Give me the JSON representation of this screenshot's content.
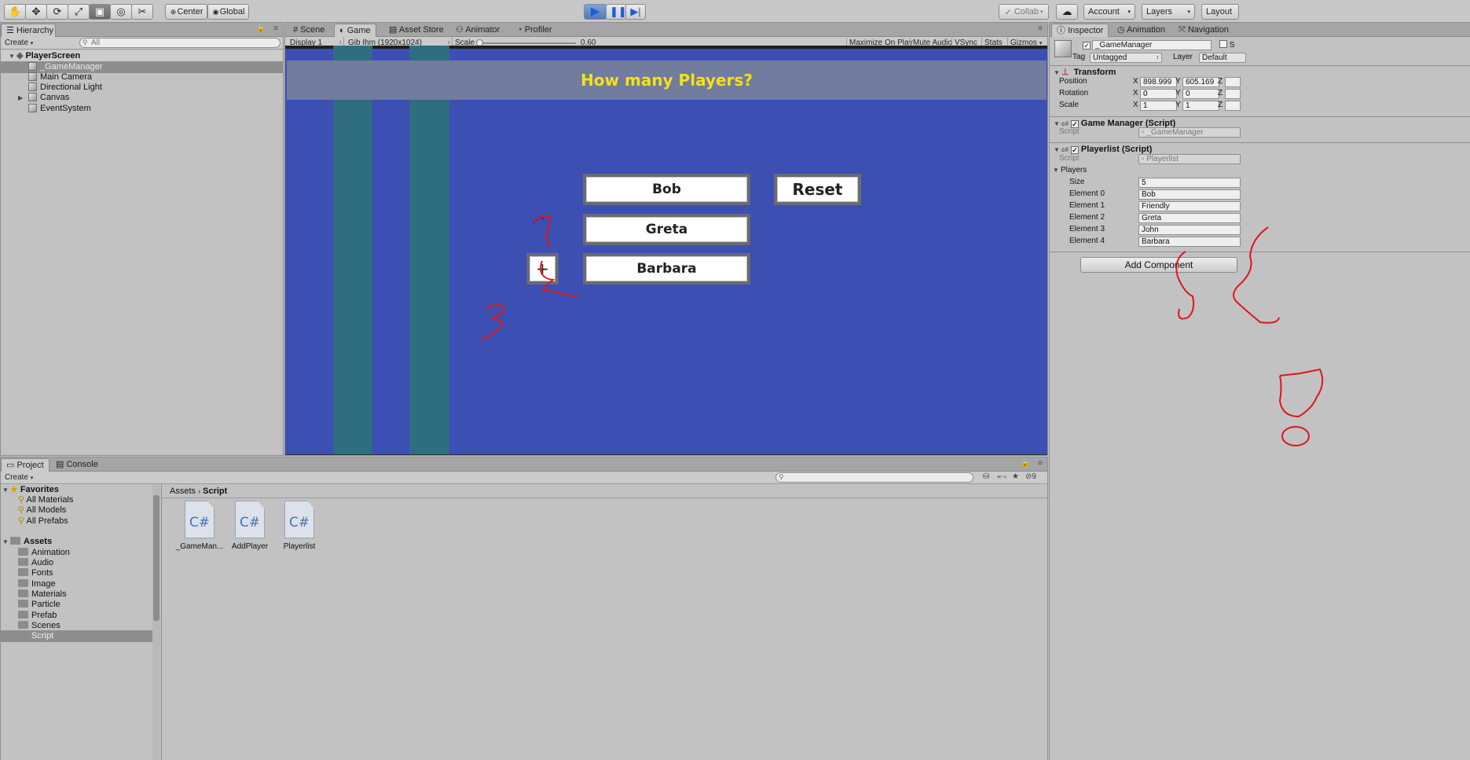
{
  "toolbar": {
    "pivot_center": "Center",
    "pivot_global": "Global",
    "collab": "Collab",
    "account": "Account",
    "layers": "Layers",
    "layout": "Layout"
  },
  "hierarchy": {
    "tab": "Hierarchy",
    "create": "Create",
    "search_placeholder": "All",
    "scene": "PlayerScreen",
    "items": [
      "_GameManager",
      "Main Camera",
      "Directional Light",
      "Canvas",
      "EventSystem"
    ]
  },
  "view_tabs": {
    "scene": "Scene",
    "game": "Game",
    "asset_store": "Asset Store",
    "animator": "Animator",
    "profiler": "Profiler"
  },
  "game_bar": {
    "display": "Display 1",
    "resolution": "Gib Ihm (1920x1024)",
    "scale_label": "Scale",
    "scale_value": "0.60",
    "scale_fraction": 0.0,
    "maximize": "Maximize On Play",
    "mute": "Mute Audio",
    "vsync": "VSync",
    "stats": "Stats",
    "gizmos": "Gizmos"
  },
  "game": {
    "title": "How many Players?",
    "players": [
      "Bob",
      "Greta",
      "Barbara"
    ],
    "reset": "Reset",
    "add": "+"
  },
  "inspector": {
    "tabs": {
      "inspector": "Inspector",
      "animation": "Animation",
      "navigation": "Navigation"
    },
    "object_name": "_GameManager",
    "static_label": "S",
    "tag_label": "Tag",
    "tag": "Untagged",
    "layer_label": "Layer",
    "layer": "Default",
    "transform": {
      "title": "Transform",
      "position_label": "Position",
      "rotation_label": "Rotation",
      "scale_label": "Scale",
      "position": {
        "x": "898.999",
        "y": "605.169"
      },
      "rotation": {
        "x": "0",
        "y": "0"
      },
      "scale": {
        "x": "1",
        "y": "1"
      },
      "axis_x": "X",
      "axis_y": "Y",
      "axis_z": "Z"
    },
    "game_manager": {
      "title": "Game Manager (Script)",
      "script_label": "Script",
      "script": "_GameManager"
    },
    "playerlist": {
      "title": "Playerlist (Script)",
      "script_label": "Script",
      "script": "Playerlist",
      "players_label": "Players",
      "size_label": "Size",
      "size": "5",
      "elements": [
        {
          "label": "Element 0",
          "value": "Bob"
        },
        {
          "label": "Element 1",
          "value": "Friendly"
        },
        {
          "label": "Element 2",
          "value": "Greta"
        },
        {
          "label": "Element 3",
          "value": "John"
        },
        {
          "label": "Element 4",
          "value": "Barbara"
        }
      ]
    },
    "add_component": "Add Component"
  },
  "project": {
    "tab_project": "Project",
    "tab_console": "Console",
    "create": "Create",
    "hidden_count": "9",
    "favorites_label": "Favorites",
    "favorites": [
      "All Materials",
      "All Models",
      "All Prefabs"
    ],
    "assets_label": "Assets",
    "folders": [
      "Animation",
      "Audio",
      "Fonts",
      "Image",
      "Materials",
      "Particle",
      "Prefab",
      "Scenes",
      "Script"
    ],
    "breadcrumb": [
      "Assets",
      "Script"
    ],
    "files": [
      {
        "icon": "C#",
        "name": "_GameMan..."
      },
      {
        "icon": "C#",
        "name": "AddPlayer"
      },
      {
        "icon": "C#",
        "name": "Playerlist"
      }
    ]
  }
}
